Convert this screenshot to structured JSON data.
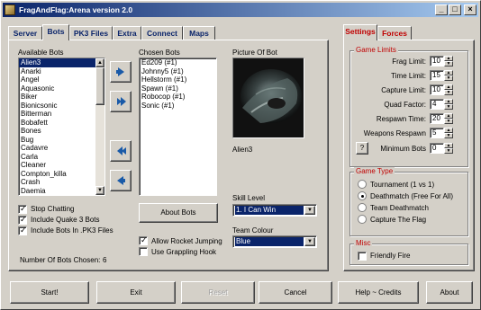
{
  "window": {
    "title": "FragAndFlag:Arena version 2.0",
    "icon": "app-icon",
    "controls": [
      "minimize",
      "maximize",
      "close"
    ]
  },
  "left_tabs": [
    {
      "label": "Server",
      "active": false
    },
    {
      "label": "Bots",
      "active": true
    },
    {
      "label": "PK3 Files",
      "active": false
    },
    {
      "label": "Extra",
      "active": false
    },
    {
      "label": "Connect",
      "active": false
    },
    {
      "label": "Maps",
      "active": false
    }
  ],
  "bots": {
    "available_label": "Available Bots",
    "available": [
      "Alien3",
      "Anarki",
      "Angel",
      "Aquasonic",
      "Biker",
      "Bionicsonic",
      "Bitterman",
      "Bobafett",
      "Bones",
      "Bug",
      "Cadavre",
      "Carla",
      "Cleaner",
      "Compton_killa",
      "Crash",
      "Daemia"
    ],
    "selected_available": "Alien3",
    "chosen_label": "Chosen Bots",
    "chosen": [
      "Ed209 (#1)",
      "Johnny5 (#1)",
      "Hellstorm (#1)",
      "Spawn (#1)",
      "Robocop (#1)",
      "Sonic (#1)"
    ],
    "picture_label": "Picture Of Bot",
    "picture_name": "Alien3",
    "skill_label": "Skill Level",
    "skill_value": "1. I Can Win",
    "team_label": "Team Colour",
    "team_value": "Blue",
    "about_button": "About Bots",
    "options": [
      {
        "label": "Stop Chatting",
        "checked": true
      },
      {
        "label": "Include Quake 3 Bots",
        "checked": true
      },
      {
        "label": "Include Bots In .PK3 Files",
        "checked": true
      }
    ],
    "allow_rocket_jumping": {
      "label": "Allow Rocket Jumping",
      "checked": true
    },
    "use_grappling_hook": {
      "label": "Use Grappling Hook",
      "checked": false
    },
    "count_label": "Number Of Bots Chosen:",
    "count_value": "6"
  },
  "right_tabs": [
    {
      "label": "Settings",
      "active": true
    },
    {
      "label": "Forces",
      "active": false
    }
  ],
  "game_limits": {
    "title": "Game Limits",
    "fields": [
      {
        "label": "Frag Limit:",
        "value": "10"
      },
      {
        "label": "Time Limit:",
        "value": "15"
      },
      {
        "label": "Capture Limit:",
        "value": "10"
      },
      {
        "label": "Quad Factor:",
        "value": "4"
      },
      {
        "label": "Respawn Time:",
        "value": "20"
      },
      {
        "label": "Weapons Respawn",
        "value": "5"
      },
      {
        "label": "Minimum Bots",
        "value": "0"
      }
    ],
    "help_label": "?"
  },
  "game_type": {
    "title": "Game Type",
    "options": [
      {
        "label": "Tournament (1 vs 1)",
        "selected": false
      },
      {
        "label": "Deathmatch (Free For All)",
        "selected": true
      },
      {
        "label": "Team Deathmatch",
        "selected": false
      },
      {
        "label": "Capture The Flag",
        "selected": false
      }
    ]
  },
  "misc": {
    "title": "Misc",
    "friendly_fire": {
      "label": "Friendly Fire",
      "checked": false
    }
  },
  "bottom_buttons": [
    {
      "label": "Start!",
      "enabled": true
    },
    {
      "label": "Exit",
      "enabled": true
    },
    {
      "label": "Reset",
      "enabled": false
    },
    {
      "label": "Cancel",
      "enabled": true
    },
    {
      "label": "Help ~ Credits",
      "enabled": true
    },
    {
      "label": "About",
      "enabled": true
    }
  ],
  "colors": {
    "face": "#d4d0c8",
    "title_start": "#0a246a",
    "title_end": "#a6caf0",
    "selection": "#0a246a",
    "tab_text": "#0a246a",
    "group_title": "#c00000",
    "arrow": "#1a5aa8"
  }
}
